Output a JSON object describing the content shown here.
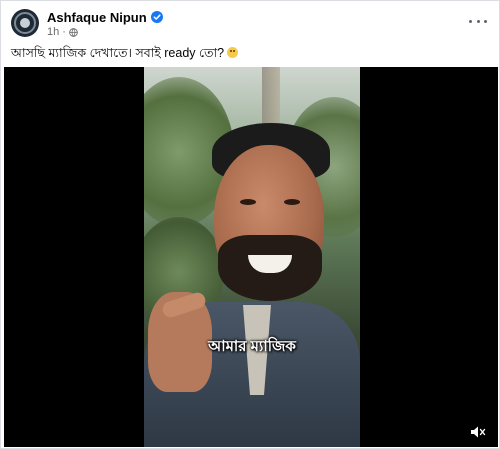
{
  "post": {
    "author": "Ashfaque Nipun",
    "time": "1h",
    "caption": "আসছি ম্যাজিক দেখাতে। সবাই ready তো?"
  },
  "video": {
    "subtitle": "আমার ম্যাজিক"
  },
  "icons": {
    "verified": "verified-badge-icon",
    "privacy": "globe-icon",
    "menu": "more-options-icon",
    "sound": "volume-icon",
    "emoji": "smiling-face-emoji"
  },
  "colors": {
    "verified": "#1877f2",
    "meta_text": "#65676b",
    "video_bg": "#000000"
  }
}
